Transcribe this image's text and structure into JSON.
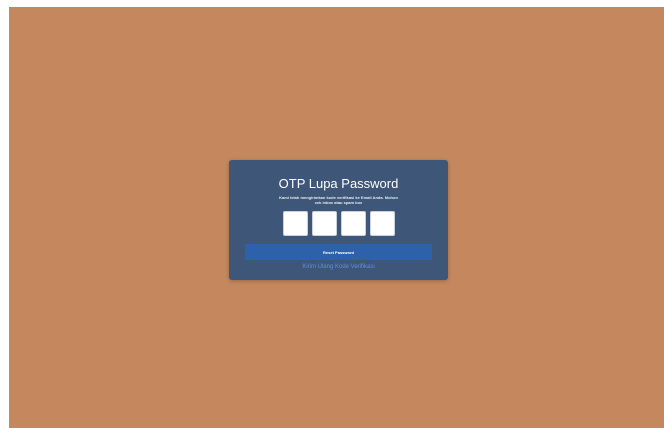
{
  "colors": {
    "background": "#c5885e",
    "card": "#3e5677",
    "button": "#2d62ab",
    "link": "#5b91e2"
  },
  "card": {
    "title": "OTP Lupa Password",
    "description": "Kami telah mengirimkan kode verifikasi ke Email Anda. Mohon cek inbox atau spam box",
    "otp_fields": [
      "",
      "",
      "",
      ""
    ],
    "reset_button_label": "Reset Password",
    "resend_link_label": "Kirim Ulang Kode Verifikasi"
  }
}
